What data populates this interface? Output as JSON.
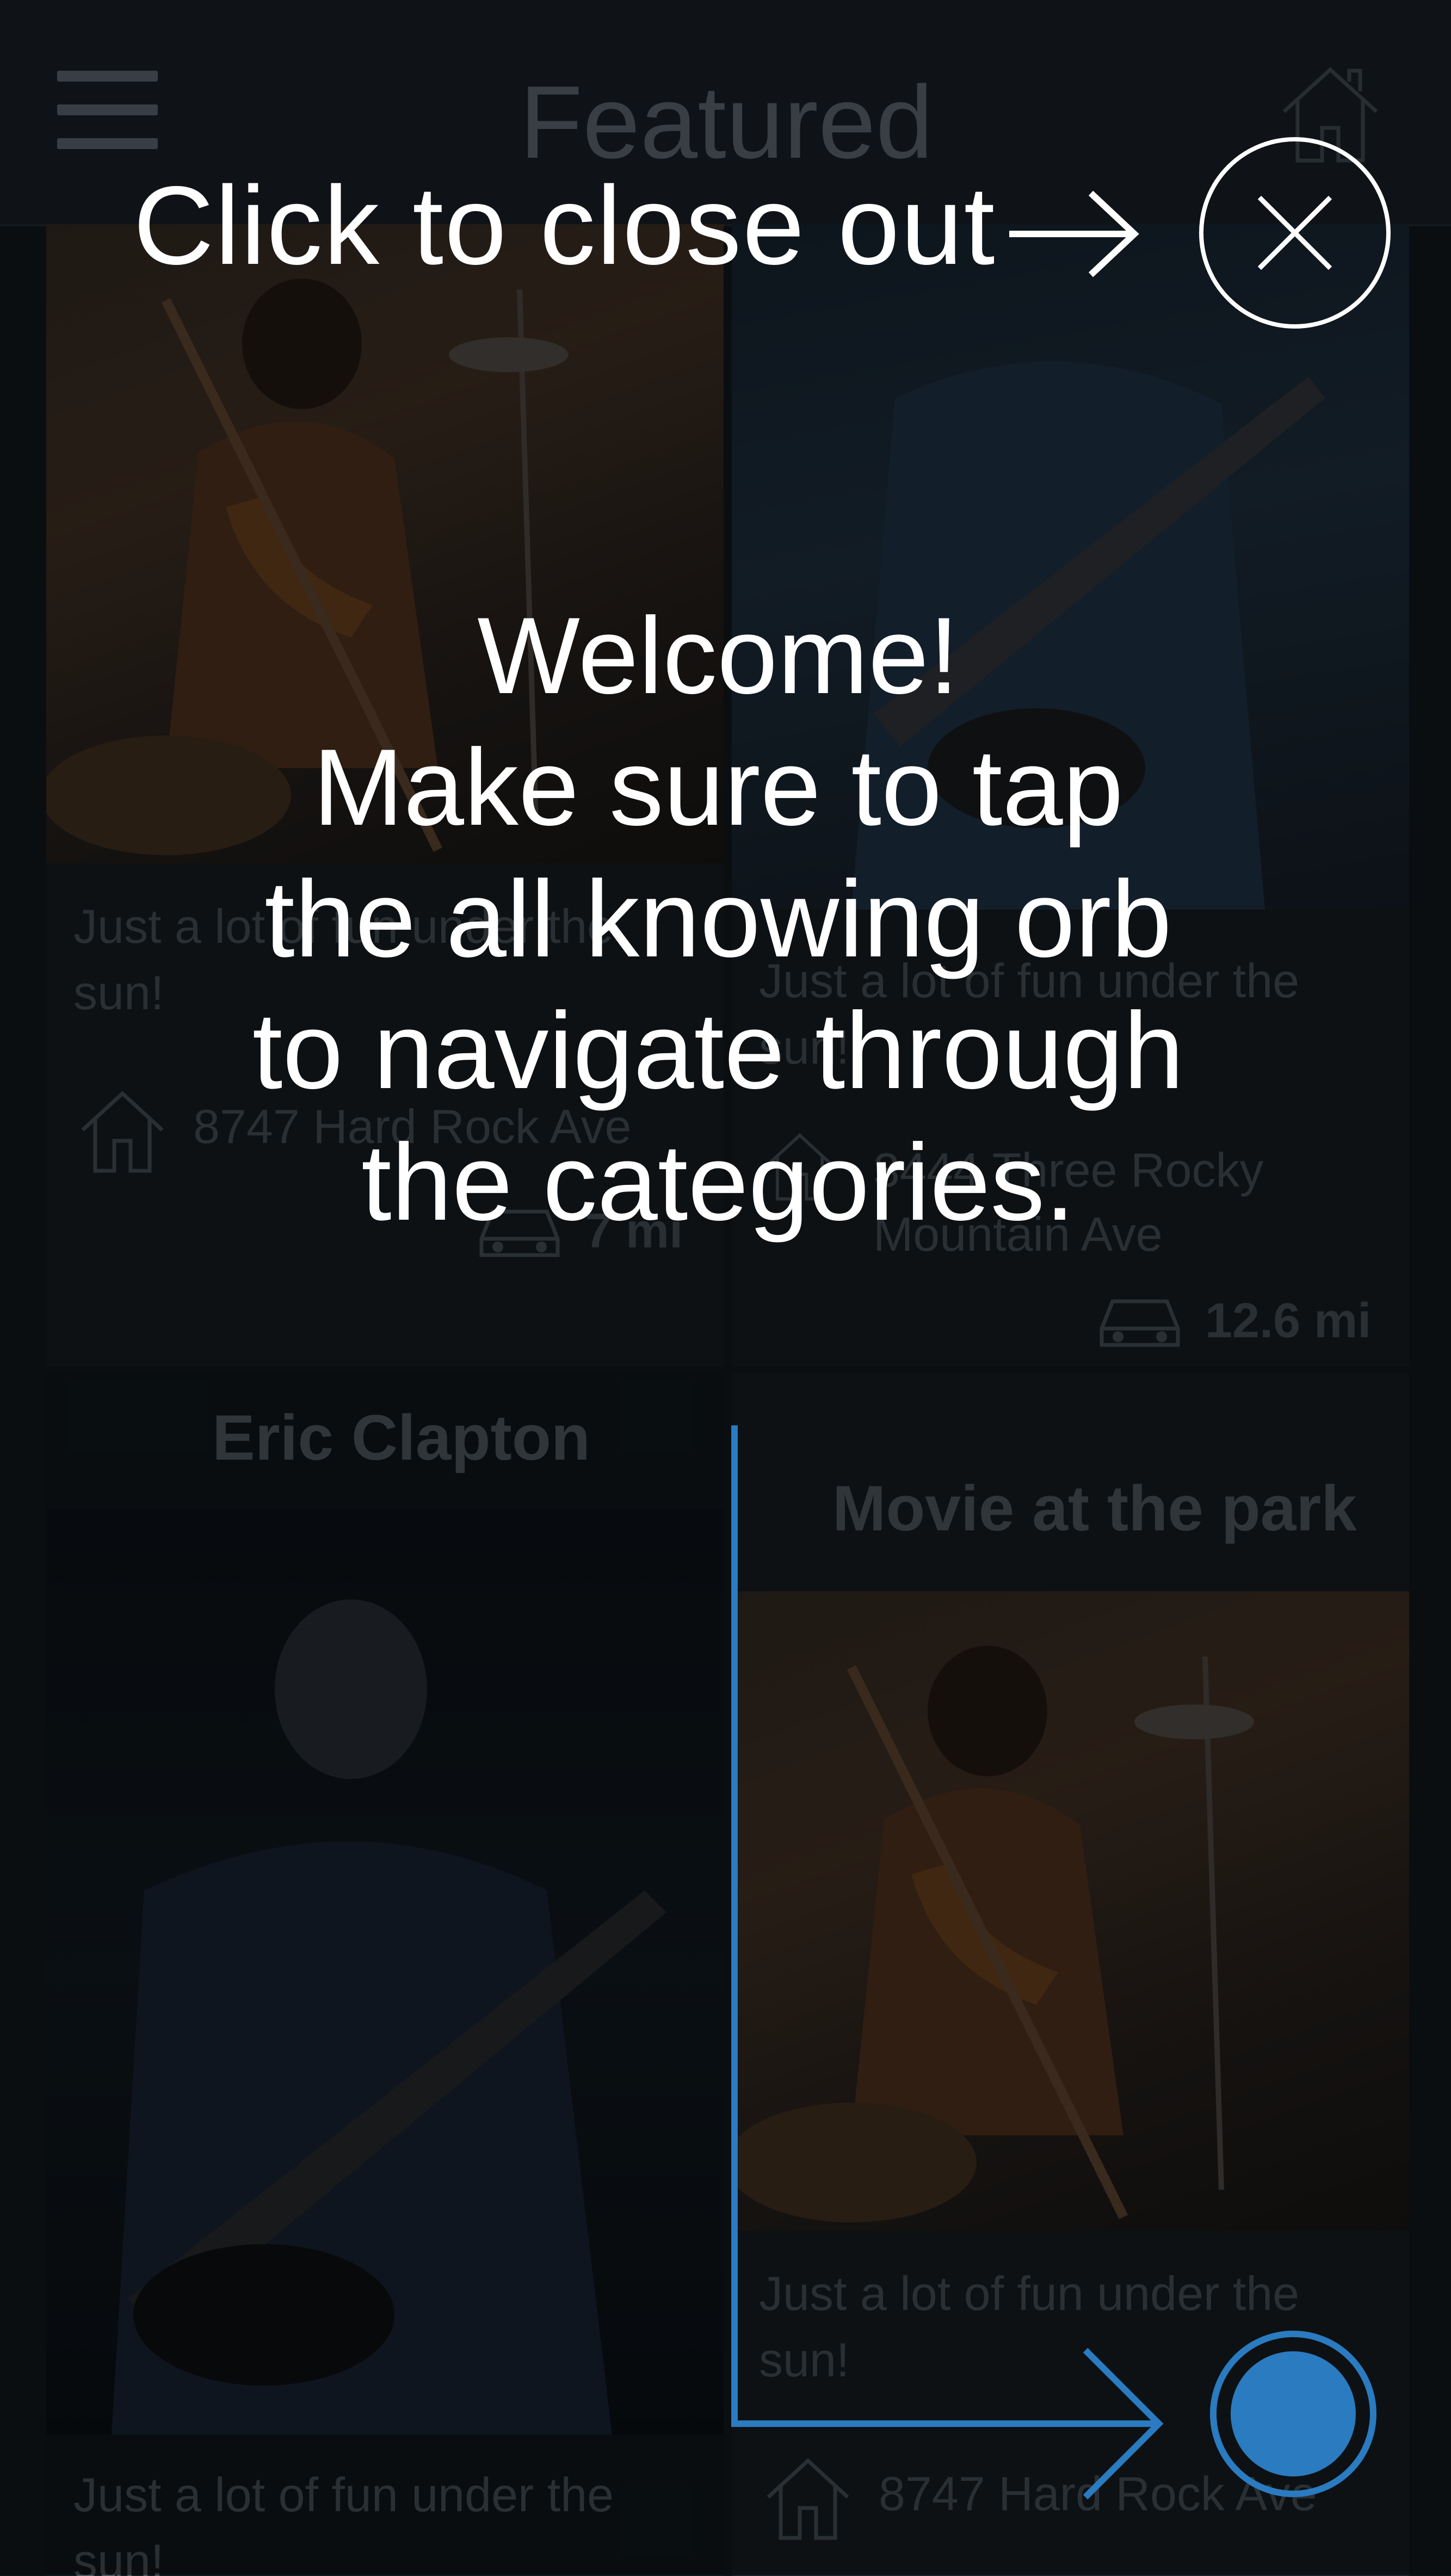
{
  "header": {
    "title": "Featured",
    "menu_icon": "hamburger-menu-icon",
    "home_icon": "home-icon"
  },
  "cards": [
    {
      "title": "",
      "description": "Just a lot of fun under the sun!",
      "address": "8747 Hard Rock Ave",
      "distance": "7 mi"
    },
    {
      "title": "",
      "description": "Just a lot of fun under the sun!",
      "address": "3444 Three Rocky Mountain Ave",
      "distance": "12.6 mi"
    },
    {
      "title": "Eric Clapton",
      "description": "Just a lot of fun under the sun!",
      "address": "",
      "distance": ""
    },
    {
      "title": "Movie at the park",
      "description": "Just a lot of fun under the sun!",
      "address": "8747 Hard Rock Ave",
      "distance": ""
    }
  ],
  "overlay": {
    "close_hint": "Click to close out",
    "close_icon": "close-icon",
    "welcome_lines": [
      "Welcome!",
      "Make sure to tap",
      "the all knowing orb",
      "to navigate through",
      "the categories."
    ],
    "orb_icon": "orb-button-icon",
    "accent_color": "#2a7bc0"
  }
}
